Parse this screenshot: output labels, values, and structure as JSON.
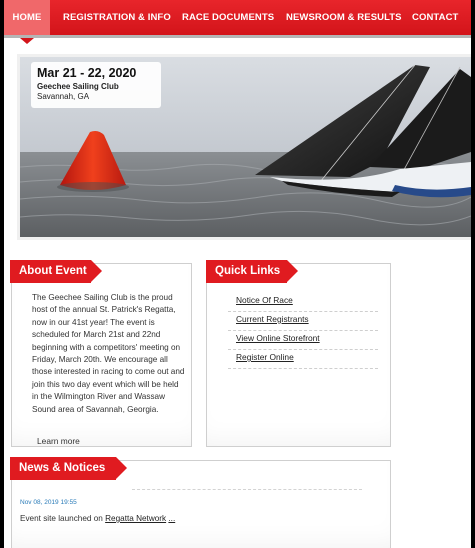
{
  "nav": {
    "items": [
      {
        "label": "HOME"
      },
      {
        "label": "REGISTRATION & INFO"
      },
      {
        "label": "RACE DOCUMENTS"
      },
      {
        "label": "NEWSROOM & RESULTS"
      },
      {
        "label": "CONTACT"
      }
    ]
  },
  "hero": {
    "date": "Mar 21 - 22, 2020",
    "club": "Geechee Sailing Club",
    "location": "Savannah, GA"
  },
  "about": {
    "title": "About Event",
    "lines": [
      "The Geechee Sailing Club is the proud",
      "host of the annual St. Patrick's Regatta,",
      "now in our 41st year! The event is",
      "scheduled for March 21st and 22nd",
      "beginning with a competitors' meeting on",
      "Friday, March 20th. We encourage all",
      "those interested in racing to come out and",
      "join this two day event which will be held",
      "in the Wilmington River and Wassaw",
      "Sound area of Savannah, Georgia."
    ],
    "learn_more": "Learn more"
  },
  "quick_links": {
    "title": "Quick Links",
    "links": [
      {
        "label": "Notice Of Race"
      },
      {
        "label": "Current Registrants"
      },
      {
        "label": "View Online Storefront"
      },
      {
        "label": "Register Online"
      }
    ]
  },
  "news": {
    "title": "News & Notices",
    "items": [
      {
        "date": "Nov 08, 2019 19:55",
        "text": "Event site launched on",
        "link": "Regatta Network",
        "more": "..."
      }
    ]
  },
  "colors": {
    "accent": "#e01b20",
    "nav_home": "#f0686a",
    "date_link": "#2a7bb8"
  }
}
